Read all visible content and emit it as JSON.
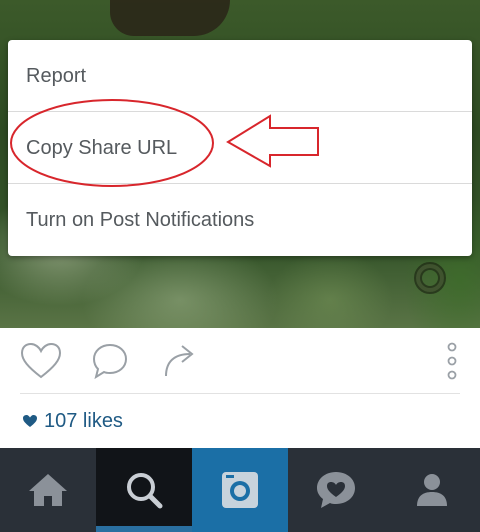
{
  "menu": {
    "items": [
      {
        "label": "Report"
      },
      {
        "label": "Copy Share URL"
      },
      {
        "label": "Turn on Post Notifications"
      }
    ]
  },
  "post": {
    "likes_text": "107 likes",
    "actions": [
      "like-icon",
      "comment-icon",
      "share-icon",
      "more-options-icon"
    ]
  },
  "nav": {
    "tabs": [
      "home-icon",
      "search-icon",
      "camera-icon",
      "activity-icon",
      "profile-icon"
    ],
    "active": "search-icon"
  },
  "colors": {
    "likes": "#1f5a84",
    "nav_background": "#2a3038",
    "camera_tab": "#1b6fa6",
    "annotation": "#d8262c"
  }
}
